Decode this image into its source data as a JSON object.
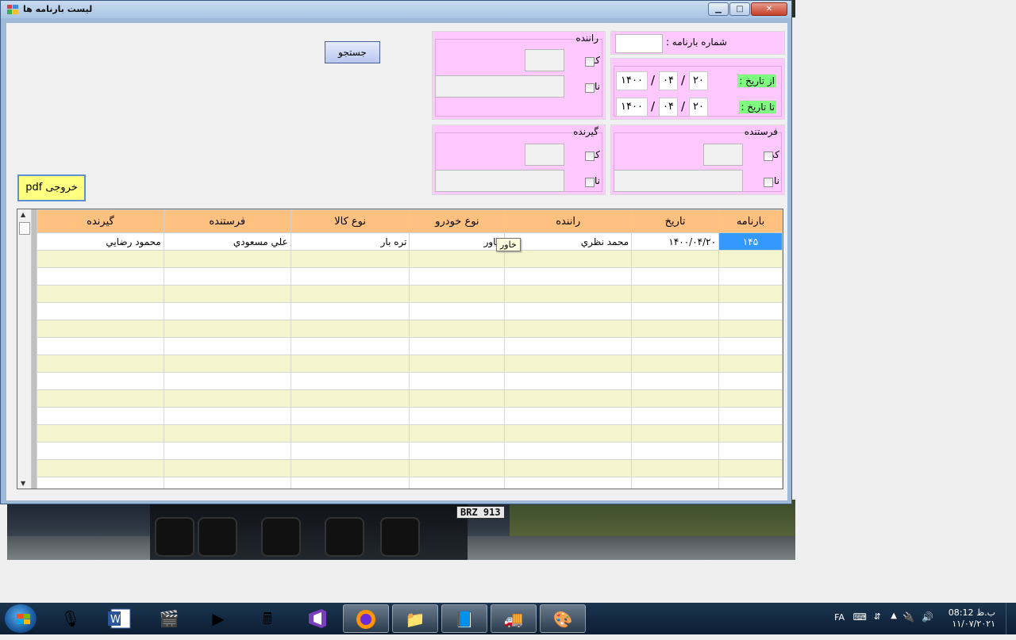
{
  "window": {
    "title": "ليست بارنامه ها",
    "controls": {
      "minimize": "▁",
      "maximize": "□",
      "close": "✕"
    }
  },
  "filters": {
    "waybill_label": "شماره بارنامه :",
    "from_date_label": "از تاريخ :",
    "to_date_label": "تا تاريخ :",
    "from_date": {
      "day": "۲۰",
      "month": "۰۴",
      "year": "۱۴۰۰"
    },
    "to_date": {
      "day": "۲۰",
      "month": "۰۴",
      "year": "۱۴۰۰"
    },
    "date_separator": "/",
    "driver": {
      "title": "راننده",
      "code_label": "كد",
      "name_label": "نام"
    },
    "sender": {
      "title": "فرستنده",
      "code_label": "كد",
      "name_label": "نام"
    },
    "receiver": {
      "title": "گيرنده",
      "code_label": "كد",
      "name_label": "نام"
    }
  },
  "buttons": {
    "search": "جستجو",
    "pdf": "خروجی pdf"
  },
  "grid": {
    "columns": [
      "بارنامه",
      "تاريخ",
      "راننده",
      "نوع خودرو",
      "نوع كالا",
      "فرستنده",
      "گيرنده"
    ],
    "rows": [
      [
        "۱۴۵",
        "۱۴۰۰/۰۴/۲۰",
        "محمد نظري",
        "خاور",
        "تره بار",
        "علي مسعودي",
        "محمود رضايي"
      ]
    ],
    "tooltip": "خاور"
  },
  "photo": {
    "plate": "BRZ 913"
  },
  "taskbar": {
    "lang": "FA",
    "time": "ب.ظ 08:12",
    "date": "۱۱/۰۷/۲۰۲۱"
  }
}
